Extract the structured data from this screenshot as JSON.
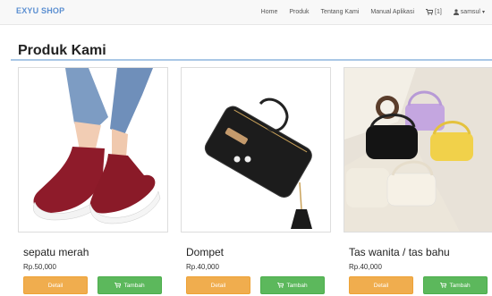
{
  "navbar": {
    "brand": "EXYU SHOP",
    "links": [
      "Home",
      "Produk",
      "Tentang Kami",
      "Manual Aplikasi"
    ],
    "cart_count": "[1]",
    "user": "samsul"
  },
  "page": {
    "title": "Produk Kami"
  },
  "products": [
    {
      "name": "sepatu merah",
      "price": "Rp.50,000",
      "detail": "Detail",
      "add": "Tambah"
    },
    {
      "name": "Dompet",
      "price": "Rp.40,000",
      "detail": "Detail",
      "add": "Tambah"
    },
    {
      "name": "Tas wanita / tas bahu",
      "price": "Rp.40,000",
      "detail": "Detail",
      "add": "Tambah"
    }
  ],
  "colors": {
    "brand": "#5b8fd1",
    "detail_button": "#f0ad4e",
    "add_button": "#5cb85c"
  },
  "icons": {
    "cart": "cart-icon",
    "user": "user-icon",
    "add": "cart-icon",
    "caret": "caret-down-icon"
  }
}
